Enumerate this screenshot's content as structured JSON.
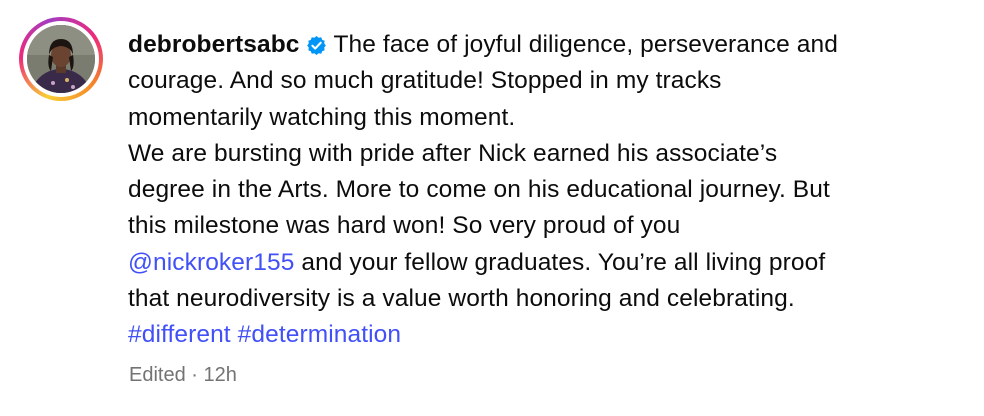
{
  "post": {
    "username": "debrobertsabc",
    "caption_lines": [
      "The face of joyful diligence, perseverance and",
      "courage. And so much gratitude! Stopped in my tracks",
      "momentarily watching this moment.",
      "We are bursting with pride after Nick earned his associate’s",
      "degree in the Arts. More to come on his educational journey. But",
      "this milestone was hard won! So very proud of you"
    ],
    "mention": "@nickroker155",
    "mention_suffix": " and your fellow graduates. You’re all living proof",
    "line8": "that neurodiversity is a value worth honoring and celebrating.",
    "hashtags": [
      "#different",
      "#determination"
    ],
    "edited_label": "Edited",
    "separator": " · ",
    "time_ago": "12h"
  },
  "colors": {
    "link": "#4150f7",
    "meta": "#737373",
    "verified": "#0095f6"
  },
  "icons": {
    "verified": "verified-badge-icon",
    "avatar": "user-avatar"
  }
}
